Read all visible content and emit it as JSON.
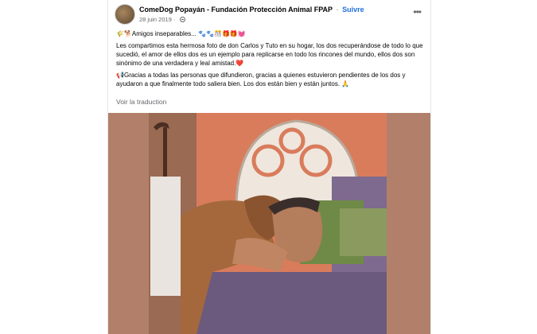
{
  "post": {
    "author": "ComeDog Popayán - Fundación Protección Animal FPAP",
    "separator": "·",
    "follow_label": "Suivre",
    "date": "28 juin 2019",
    "dot": "·",
    "more_icon": "more-horizontal-icon",
    "privacy_icon": "globe-icon",
    "lines": [
      {
        "emoji": "🌾🐕",
        "text": "Amigos inseparables... ",
        "trailing_emoji": "🐾🐾🎊🎁🎁💓"
      },
      {
        "text": "Les compartimos esta hermosa foto de don Carlos y Tuto en su hogar, los dos recuperándose de todo lo que sucedió, el amor de ellos dos es un ejemplo para replicarse en todo los rincones del mundo, ellos dos son sinónimo de una verdadera y leal amistad.",
        "trailing_emoji": "❤️"
      },
      {
        "emoji": "📢",
        "text": "Gracias a todas las personas que difundieron, gracias a quienes estuvieron pendientes de los dos y ayudaron a que finalmente todo saliera bien. Los dos están bien y están juntos. ",
        "trailing_emoji": "🙏"
      }
    ],
    "see_translation": "Voir la traduction"
  },
  "colors": {
    "link_blue": "#216fdb",
    "secondary_text": "#65676b",
    "photo_bg": "#b2806a"
  }
}
